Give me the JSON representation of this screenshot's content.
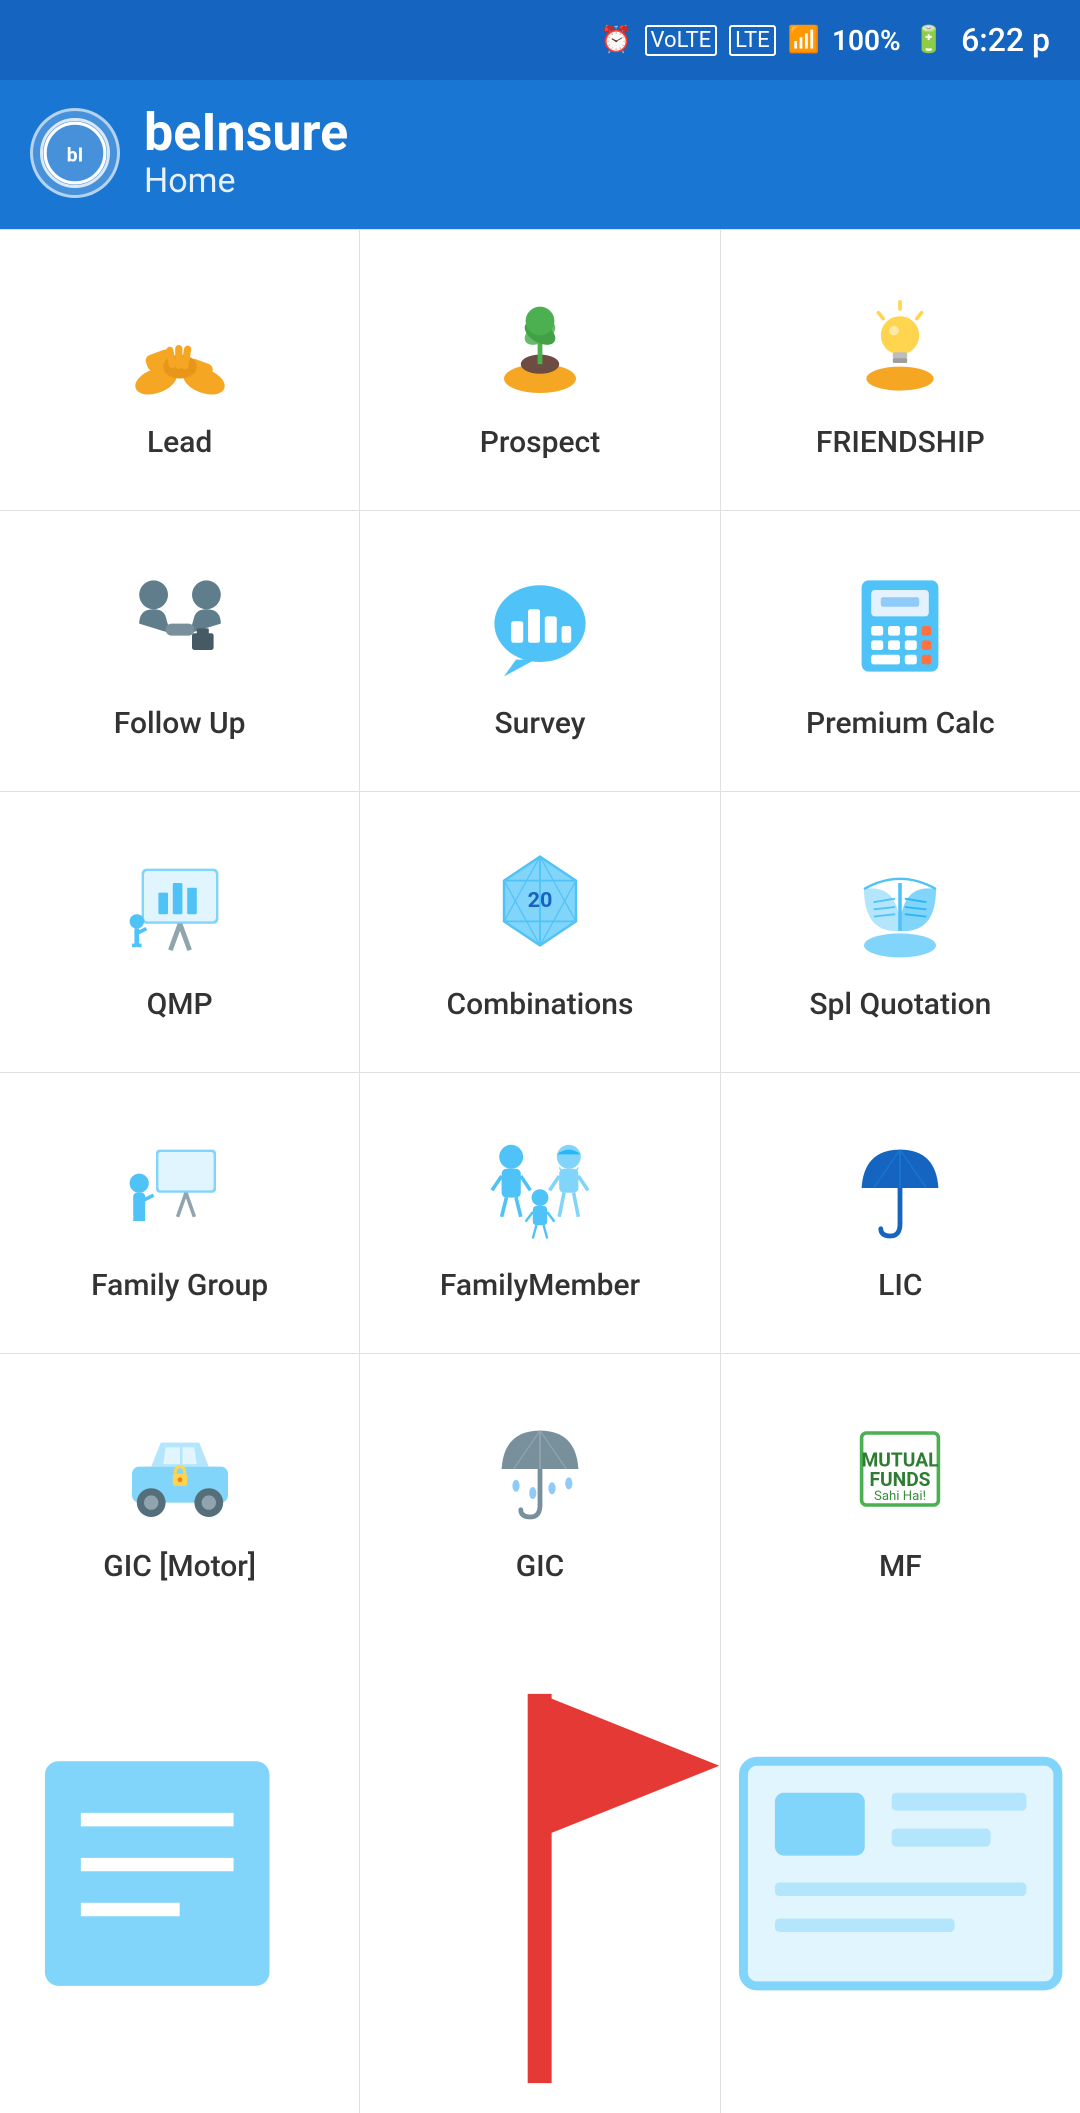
{
  "statusBar": {
    "time": "6:22 p",
    "battery": "100%",
    "signal": "LTE"
  },
  "header": {
    "appName": "beInsure",
    "screenName": "Home",
    "logoText": "bI"
  },
  "grid": {
    "items": [
      {
        "id": "lead",
        "label": "Lead",
        "iconType": "handshake"
      },
      {
        "id": "prospect",
        "label": "Prospect",
        "iconType": "plant-hand"
      },
      {
        "id": "friendship",
        "label": "FRIENDSHIP",
        "iconType": "lightbulb-hand"
      },
      {
        "id": "followup",
        "label": "Follow Up",
        "iconType": "deal"
      },
      {
        "id": "survey",
        "label": "Survey",
        "iconType": "chart-bubble"
      },
      {
        "id": "premium-calc",
        "label": "Premium Calc",
        "iconType": "calculator"
      },
      {
        "id": "qmp",
        "label": "QMP",
        "iconType": "presentation"
      },
      {
        "id": "combinations",
        "label": "Combinations",
        "iconType": "dice-20"
      },
      {
        "id": "spl-quotation",
        "label": "Spl Quotation",
        "iconType": "book-hand"
      },
      {
        "id": "family-group",
        "label": "Family Group",
        "iconType": "person-board"
      },
      {
        "id": "family-member",
        "label": "FamilyMember",
        "iconType": "family"
      },
      {
        "id": "lic",
        "label": "LIC",
        "iconType": "umbrella-blue"
      },
      {
        "id": "gic-motor",
        "label": "GIC [Motor]",
        "iconType": "car"
      },
      {
        "id": "gic",
        "label": "GIC",
        "iconType": "umbrella-gray"
      },
      {
        "id": "mf",
        "label": "MF",
        "iconType": "mutual-funds"
      }
    ]
  },
  "colors": {
    "headerBg": "#1976d2",
    "iconBlue": "#4fc3f7",
    "iconOrange": "#f5a623",
    "iconDarkBlue": "#1e88e5",
    "divider": "#e0e0e0"
  }
}
